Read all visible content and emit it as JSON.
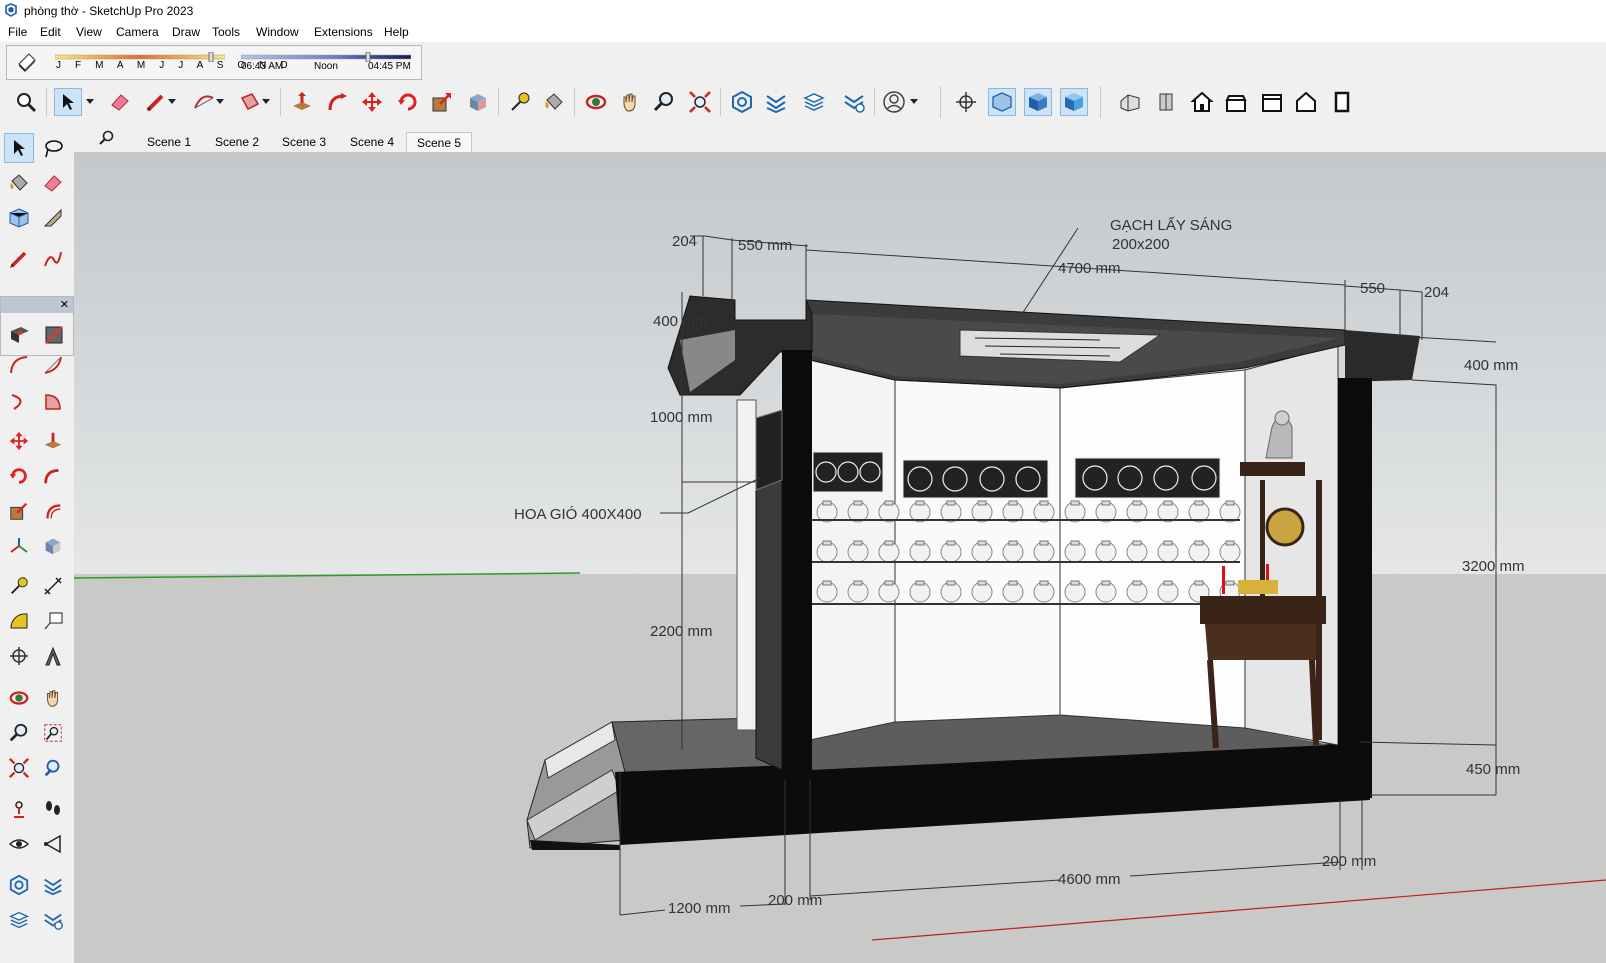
{
  "window": {
    "title": "phòng thờ - SketchUp Pro 2023"
  },
  "menu": [
    "File",
    "Edit",
    "View",
    "Camera",
    "Draw",
    "Tools",
    "Window",
    "Extensions",
    "Help"
  ],
  "shadows": {
    "months": "J F M A M J J A S O N D",
    "time_start": "06:43 AM",
    "time_mid": "Noon",
    "time_end": "04:45 PM",
    "date_fill": 0.93,
    "time_fill": 0.75
  },
  "scenes": {
    "tabs": [
      "Scene 1",
      "Scene 2",
      "Scene 3",
      "Scene 4",
      "Scene 5"
    ],
    "active": "Scene 5"
  },
  "model_labels": {
    "d204_left": "204",
    "d550_left": "550 mm",
    "gach_title": "GẠCH LẤY SÁNG",
    "gach_size": "200x200",
    "d4700": "4700 mm",
    "d550_right": "550",
    "d204_right": "204",
    "d400_left": "400 mm",
    "d400_right": "400 mm",
    "d1000": "1000 mm",
    "hoa_gio": "HOA GIÓ  400X400",
    "d2200": "2200 mm",
    "d3200": "3200 mm",
    "d450": "450 mm",
    "d200_right": "200 mm",
    "d4600": "4600 mm",
    "d1200": "1200 mm",
    "d200_bottom": "200 mm"
  },
  "colors": {
    "sky_top": "#c4c8cb",
    "sky_bottom": "#e4e6e7",
    "ground": "#c9c9c7",
    "wall_dark": "#111111",
    "axis_green": "#2e9a2e",
    "axis_red": "#c02020"
  }
}
